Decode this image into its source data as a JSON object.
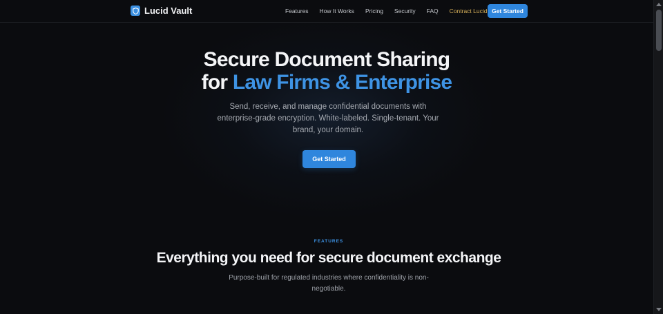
{
  "brand": {
    "name": "Lucid Vault",
    "logo_icon": "shield-icon",
    "accent": "#3b8fe0"
  },
  "nav": {
    "items": [
      {
        "label": "Features"
      },
      {
        "label": "How It Works"
      },
      {
        "label": "Pricing"
      },
      {
        "label": "Security"
      },
      {
        "label": "FAQ"
      },
      {
        "label": "Contract Lucidity",
        "accent": "#d8b15a"
      }
    ],
    "cta_label": "Get Started"
  },
  "hero": {
    "title_line1": "Secure Document Sharing",
    "title_line2_prefix": "for",
    "title_line2_accent": "Law Firms & Enterprise",
    "subtitle": "Send, receive, and manage confidential documents with enterprise-grade encryption. White-labeled. Single-tenant. Your brand, your domain.",
    "cta_label": "Get Started"
  },
  "features": {
    "kicker": "FEATURES",
    "title": "Everything you need for secure document exchange",
    "subtitle": "Purpose-built for regulated industries where confidentiality is non-negotiable."
  },
  "colors": {
    "background": "#0b0c0f",
    "primary": "#2f86dd",
    "accent_text": "#3e93e4",
    "gold": "#d8b15a"
  }
}
